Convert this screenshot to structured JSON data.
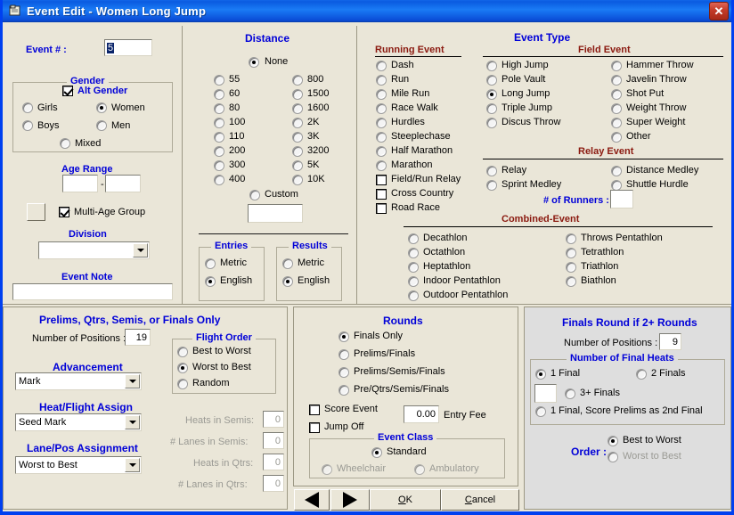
{
  "window": {
    "title": "Event Edit  -  Women Long Jump",
    "icon": "window-document-icon",
    "close_label": "✕",
    "border_color": "#0040F0",
    "titlebar_color": "#1266E8",
    "background_color": "#EAE6D8",
    "panel_gray_color": "#DEDEDE",
    "label_blue": "#0000D8",
    "heading_darkred": "#8B1A10"
  },
  "event": {
    "number_label": "Event # :",
    "number_value": "5"
  },
  "gender": {
    "title": "Gender",
    "alt_gender_label": "Alt Gender",
    "alt_gender_checked": true,
    "options": [
      {
        "label": "Girls",
        "selected": false
      },
      {
        "label": "Women",
        "selected": true
      },
      {
        "label": "Boys",
        "selected": false
      },
      {
        "label": "Men",
        "selected": false
      },
      {
        "label": "Mixed",
        "selected": false
      }
    ]
  },
  "age_range": {
    "title": "Age Range",
    "from": "",
    "to": "",
    "separator": "-"
  },
  "multi_age": {
    "label": "Multi-Age Group",
    "checked": true,
    "button_label": ""
  },
  "division": {
    "title": "Division",
    "value": ""
  },
  "event_note": {
    "title": "Event Note",
    "value": ""
  },
  "distance": {
    "title": "Distance",
    "none": {
      "label": "None",
      "selected": true
    },
    "left_column": [
      {
        "label": "55",
        "selected": false
      },
      {
        "label": "60",
        "selected": false
      },
      {
        "label": "80",
        "selected": false
      },
      {
        "label": "100",
        "selected": false
      },
      {
        "label": "110",
        "selected": false
      },
      {
        "label": "200",
        "selected": false
      },
      {
        "label": "300",
        "selected": false
      },
      {
        "label": "400",
        "selected": false
      }
    ],
    "right_column": [
      {
        "label": "800",
        "selected": false
      },
      {
        "label": "1500",
        "selected": false
      },
      {
        "label": "1600",
        "selected": false
      },
      {
        "label": "2K",
        "selected": false
      },
      {
        "label": "3K",
        "selected": false
      },
      {
        "label": "3200",
        "selected": false
      },
      {
        "label": "5K",
        "selected": false
      },
      {
        "label": "10K",
        "selected": false
      }
    ],
    "custom": {
      "label": "Custom",
      "selected": false,
      "value": ""
    }
  },
  "entries": {
    "title": "Entries",
    "options": [
      {
        "label": "Metric",
        "selected": false
      },
      {
        "label": "English",
        "selected": true
      }
    ]
  },
  "results": {
    "title": "Results",
    "options": [
      {
        "label": "Metric",
        "selected": false
      },
      {
        "label": "English",
        "selected": true
      }
    ]
  },
  "event_type": {
    "title": "Event Type",
    "running": {
      "title": "Running Event",
      "radios": [
        {
          "label": "Dash",
          "selected": false
        },
        {
          "label": "Run",
          "selected": false
        },
        {
          "label": "Mile Run",
          "selected": false
        },
        {
          "label": "Race Walk",
          "selected": false
        },
        {
          "label": "Hurdles",
          "selected": false
        },
        {
          "label": "Steeplechase",
          "selected": false
        },
        {
          "label": "Half Marathon",
          "selected": false
        },
        {
          "label": "Marathon",
          "selected": false
        }
      ],
      "checks": [
        {
          "label": "Field/Run Relay",
          "checked": false
        },
        {
          "label": "Cross Country",
          "checked": false
        },
        {
          "label": "Road Race",
          "checked": false
        }
      ]
    },
    "field": {
      "title": "Field Event",
      "left": [
        {
          "label": "High Jump",
          "selected": false
        },
        {
          "label": "Pole Vault",
          "selected": false
        },
        {
          "label": "Long Jump",
          "selected": true
        },
        {
          "label": "Triple Jump",
          "selected": false
        },
        {
          "label": "Discus Throw",
          "selected": false
        }
      ],
      "right": [
        {
          "label": "Hammer Throw",
          "selected": false
        },
        {
          "label": "Javelin Throw",
          "selected": false
        },
        {
          "label": "Shot Put",
          "selected": false
        },
        {
          "label": "Weight Throw",
          "selected": false
        },
        {
          "label": "Super Weight",
          "selected": false
        },
        {
          "label": "Other",
          "selected": false
        }
      ]
    },
    "relay": {
      "title": "Relay Event",
      "left": [
        {
          "label": "Relay",
          "selected": false
        },
        {
          "label": "Sprint Medley",
          "selected": false
        }
      ],
      "right": [
        {
          "label": "Distance Medley",
          "selected": false
        },
        {
          "label": "Shuttle Hurdle",
          "selected": false
        }
      ],
      "runners_label": "# of Runners :",
      "runners_value": ""
    },
    "combined": {
      "title": "Combined-Event",
      "left": [
        {
          "label": "Decathlon",
          "selected": false
        },
        {
          "label": "Octathlon",
          "selected": false
        },
        {
          "label": "Heptathlon",
          "selected": false
        },
        {
          "label": "Indoor Pentathlon",
          "selected": false
        },
        {
          "label": "Outdoor Pentathlon",
          "selected": false
        }
      ],
      "right": [
        {
          "label": "Throws Pentathlon",
          "selected": false
        },
        {
          "label": "Tetrathlon",
          "selected": false
        },
        {
          "label": "Triathlon",
          "selected": false
        },
        {
          "label": "Biathlon",
          "selected": false
        }
      ]
    }
  },
  "prelims": {
    "title": "Prelims, Qtrs, Semis, or Finals Only",
    "positions_label": "Number of Positions :",
    "positions_value": "19",
    "advancement_title": "Advancement",
    "advancement_value": "Mark",
    "heat_assign_title": "Heat/Flight Assign",
    "heat_assign_value": "Seed Mark",
    "lane_assign_title": "Lane/Pos Assignment",
    "lane_assign_value": "Worst to Best",
    "flight_order": {
      "title": "Flight Order",
      "options": [
        {
          "label": "Best to Worst",
          "selected": false
        },
        {
          "label": "Worst to Best",
          "selected": true
        },
        {
          "label": "Random",
          "selected": false
        }
      ]
    },
    "disabled_fields": [
      {
        "label": "Heats in Semis:",
        "value": "0"
      },
      {
        "label": "# Lanes in Semis:",
        "value": "0"
      },
      {
        "label": "Heats in Qtrs:",
        "value": "0"
      },
      {
        "label": "# Lanes in Qtrs:",
        "value": "0"
      }
    ]
  },
  "rounds": {
    "title": "Rounds",
    "options": [
      {
        "label": "Finals Only",
        "selected": true
      },
      {
        "label": "Prelims/Finals",
        "selected": false
      },
      {
        "label": "Prelims/Semis/Finals",
        "selected": false
      },
      {
        "label": "Pre/Qtrs/Semis/Finals",
        "selected": false
      }
    ],
    "score_event": {
      "label": "Score Event",
      "checked": false
    },
    "jump_off": {
      "label": "Jump Off",
      "checked": false
    },
    "entry_fee": {
      "label": "Entry Fee",
      "value": "0.00"
    },
    "event_class": {
      "title": "Event Class",
      "options": [
        {
          "label": "Standard",
          "selected": true
        },
        {
          "label": "Wheelchair",
          "selected": false
        },
        {
          "label": "Ambulatory",
          "selected": false
        }
      ]
    }
  },
  "finals": {
    "title": "Finals Round if 2+ Rounds",
    "positions_label": "Number of Positions :",
    "positions_value": "9",
    "heats": {
      "title": "Number of Final Heats",
      "options": [
        {
          "label": "1 Final",
          "selected": true
        },
        {
          "label": "2 Finals",
          "selected": false
        },
        {
          "label": "3+ Finals",
          "selected": false
        },
        {
          "label": "1 Final, Score Prelims as 2nd Final",
          "selected": false
        }
      ],
      "count_value": ""
    },
    "order_label": "Order :",
    "order_options": [
      {
        "label": "Best to Worst",
        "selected": true
      },
      {
        "label": "Worst to Best",
        "selected": false
      }
    ]
  },
  "footer": {
    "prev_label": "◀",
    "next_label": "▶",
    "ok_label": "OK",
    "cancel_label": "Cancel"
  }
}
